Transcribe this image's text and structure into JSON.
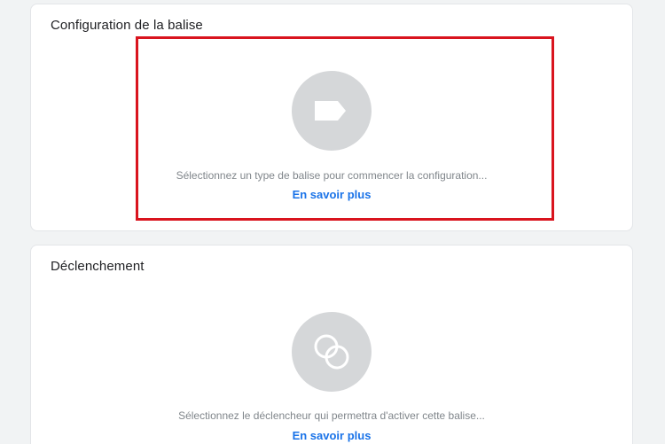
{
  "tag_configuration": {
    "title": "Configuration de la balise",
    "icon": "tag-icon",
    "description": "Sélectionnez un type de balise pour commencer la configuration...",
    "learn_more": "En savoir plus"
  },
  "triggering": {
    "title": "Déclenchement",
    "icon": "trigger-icon",
    "description": "Sélectionnez le déclencheur qui permettra d'activer cette balise...",
    "learn_more": "En savoir plus"
  },
  "colors": {
    "highlight": "#d9141e",
    "link": "#1a73e8",
    "icon_circle": "#d5d7d9"
  }
}
